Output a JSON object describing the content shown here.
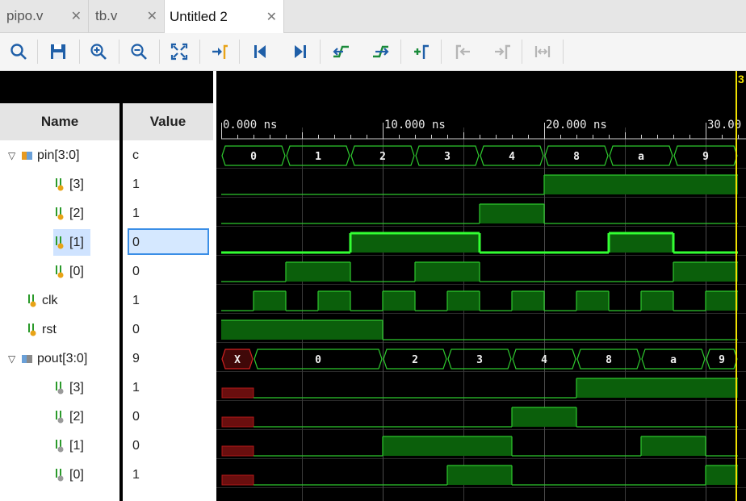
{
  "tabs": [
    {
      "label": "pipo.v",
      "active": false
    },
    {
      "label": "tb.v",
      "active": false
    },
    {
      "label": "Untitled 2",
      "active": true
    }
  ],
  "toolbar": {
    "buttons": [
      {
        "name": "search-icon",
        "enabled": true
      },
      {
        "name": "save-icon",
        "enabled": true
      },
      {
        "name": "zoom-in-icon",
        "enabled": true
      },
      {
        "name": "zoom-out-icon",
        "enabled": true
      },
      {
        "name": "zoom-fit-icon",
        "enabled": true
      },
      {
        "name": "go-to-cursor-icon",
        "enabled": true
      },
      {
        "name": "go-to-time-zero-icon",
        "enabled": true
      },
      {
        "name": "go-to-last-time-icon",
        "enabled": true
      },
      {
        "name": "previous-transition-icon",
        "enabled": true
      },
      {
        "name": "next-transition-icon",
        "enabled": true
      },
      {
        "name": "add-marker-icon",
        "enabled": true
      },
      {
        "name": "previous-marker-icon",
        "enabled": false
      },
      {
        "name": "next-marker-icon",
        "enabled": false
      },
      {
        "name": "swap-cursors-icon",
        "enabled": false
      }
    ]
  },
  "headers": {
    "name": "Name",
    "value": "Value"
  },
  "signals": [
    {
      "name": "pin[3:0]",
      "value": "c",
      "kind": "bus",
      "expanded": true
    },
    {
      "name": "[3]",
      "value": "1",
      "kind": "bit-in"
    },
    {
      "name": "[2]",
      "value": "1",
      "kind": "bit-in"
    },
    {
      "name": "[1]",
      "value": "0",
      "kind": "bit-in",
      "selected": true
    },
    {
      "name": "[0]",
      "value": "0",
      "kind": "bit-in"
    },
    {
      "name": "clk",
      "value": "1",
      "kind": "bit-top"
    },
    {
      "name": "rst",
      "value": "0",
      "kind": "bit-top"
    },
    {
      "name": "pout[3:0]",
      "value": "9",
      "kind": "bus",
      "expanded": true
    },
    {
      "name": "[3]",
      "value": "1",
      "kind": "bit-out"
    },
    {
      "name": "[2]",
      "value": "0",
      "kind": "bit-out"
    },
    {
      "name": "[1]",
      "value": "0",
      "kind": "bit-out"
    },
    {
      "name": "[0]",
      "value": "1",
      "kind": "bit-out"
    }
  ],
  "timeline": {
    "unit": "ns",
    "major_labels": [
      "0.000 ns",
      "10.000 ns",
      "20.000 ns",
      "30.00"
    ],
    "major_times": [
      0,
      10,
      20,
      30
    ],
    "view_start_ns": 0,
    "view_end_ns": 32,
    "cursor_ns": 32,
    "cursor_label": "3",
    "cursor_color": "#f0e000"
  },
  "colors": {
    "wave_green": "#2ec82e",
    "wave_fill": "#0b5f0b",
    "highlight_green": "#33ff33",
    "undefined_red": "#b01818"
  },
  "waves": [
    {
      "type": "bus",
      "segments": [
        [
          0,
          4,
          "0"
        ],
        [
          4,
          8,
          "1"
        ],
        [
          8,
          12,
          "2"
        ],
        [
          12,
          16,
          "3"
        ],
        [
          16,
          20,
          "4"
        ],
        [
          20,
          24,
          "8"
        ],
        [
          24,
          28,
          "a"
        ],
        [
          28,
          32,
          "9"
        ]
      ]
    },
    {
      "type": "bit",
      "segments": [
        [
          0,
          20,
          0
        ],
        [
          20,
          32,
          1
        ]
      ]
    },
    {
      "type": "bit",
      "segments": [
        [
          0,
          16,
          0
        ],
        [
          16,
          20,
          1
        ],
        [
          20,
          32,
          0
        ]
      ]
    },
    {
      "type": "bit",
      "highlight": true,
      "segments": [
        [
          0,
          8,
          0
        ],
        [
          8,
          16,
          1
        ],
        [
          16,
          24,
          0
        ],
        [
          24,
          28,
          1
        ],
        [
          28,
          32,
          0
        ]
      ]
    },
    {
      "type": "bit",
      "segments": [
        [
          0,
          4,
          0
        ],
        [
          4,
          8,
          1
        ],
        [
          8,
          12,
          0
        ],
        [
          12,
          16,
          1
        ],
        [
          16,
          28,
          0
        ],
        [
          28,
          32,
          1
        ]
      ]
    },
    {
      "type": "bit",
      "segments": [
        [
          0,
          2,
          0
        ],
        [
          2,
          4,
          1
        ],
        [
          4,
          6,
          0
        ],
        [
          6,
          8,
          1
        ],
        [
          8,
          10,
          0
        ],
        [
          10,
          12,
          1
        ],
        [
          12,
          14,
          0
        ],
        [
          14,
          16,
          1
        ],
        [
          16,
          18,
          0
        ],
        [
          18,
          20,
          1
        ],
        [
          20,
          22,
          0
        ],
        [
          22,
          24,
          1
        ],
        [
          24,
          26,
          0
        ],
        [
          26,
          28,
          1
        ],
        [
          28,
          30,
          0
        ],
        [
          30,
          32,
          1
        ]
      ]
    },
    {
      "type": "bit",
      "segments": [
        [
          0,
          10,
          1
        ],
        [
          10,
          32,
          0
        ]
      ]
    },
    {
      "type": "bus",
      "segments": [
        [
          0,
          2,
          "X"
        ],
        [
          2,
          10,
          "0"
        ],
        [
          10,
          14,
          "2"
        ],
        [
          14,
          18,
          "3"
        ],
        [
          18,
          22,
          "4"
        ],
        [
          22,
          26,
          "8"
        ],
        [
          26,
          30,
          "a"
        ],
        [
          30,
          32,
          "9"
        ]
      ]
    },
    {
      "type": "bit",
      "segments": [
        [
          0,
          2,
          "x"
        ],
        [
          2,
          22,
          0
        ],
        [
          22,
          32,
          1
        ]
      ]
    },
    {
      "type": "bit",
      "segments": [
        [
          0,
          2,
          "x"
        ],
        [
          2,
          18,
          0
        ],
        [
          18,
          22,
          1
        ],
        [
          22,
          32,
          0
        ]
      ]
    },
    {
      "type": "bit",
      "segments": [
        [
          0,
          2,
          "x"
        ],
        [
          2,
          10,
          0
        ],
        [
          10,
          18,
          1
        ],
        [
          18,
          26,
          0
        ],
        [
          26,
          30,
          1
        ],
        [
          30,
          32,
          0
        ]
      ]
    },
    {
      "type": "bit",
      "segments": [
        [
          0,
          2,
          "x"
        ],
        [
          2,
          14,
          0
        ],
        [
          14,
          18,
          1
        ],
        [
          18,
          30,
          0
        ],
        [
          30,
          32,
          1
        ]
      ]
    }
  ]
}
